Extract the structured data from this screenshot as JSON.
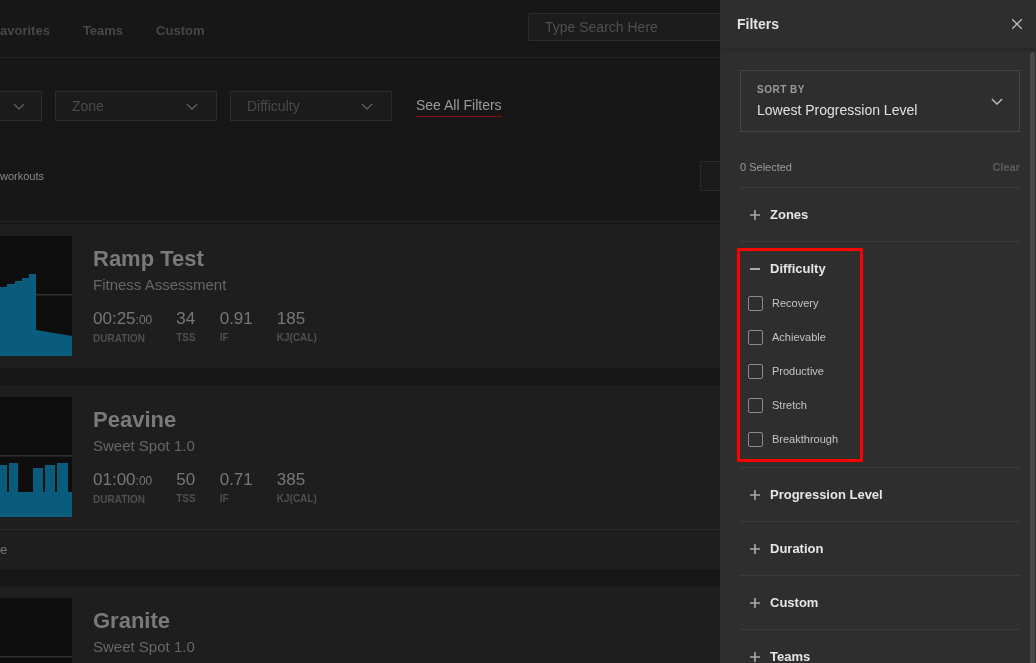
{
  "nav": {
    "tabs": [
      {
        "label": "avorites",
        "selected": false
      },
      {
        "label": "Teams",
        "selected": false
      },
      {
        "label": "Custom",
        "selected": false
      }
    ],
    "search": {
      "placeholder": "Type Search Here"
    }
  },
  "filter_bar": {
    "dropdowns": [
      {
        "kind": "clipped"
      },
      {
        "kind": "select",
        "placeholder": "Zone"
      },
      {
        "kind": "select",
        "placeholder": "Difficulty"
      }
    ],
    "link": "See All Filters"
  },
  "results": {
    "count_text": "workouts"
  },
  "workouts": [
    {
      "title": "Ramp Test",
      "subtitle": "Fitness Assessment",
      "graph": {
        "kind": "ramp"
      },
      "stats": [
        {
          "value": "00:25",
          "suffix": ":00",
          "label": "DURATION"
        },
        {
          "value": "34",
          "label": "TSS"
        },
        {
          "value": "0.91",
          "label": "IF"
        },
        {
          "value": "185",
          "label": "KJ(CAL)"
        }
      ]
    },
    {
      "title": "Peavine",
      "subtitle": "Sweet Spot 1.0",
      "graph": {
        "kind": "intervals"
      },
      "stats": [
        {
          "value": "01:00",
          "suffix": ":00",
          "label": "DURATION"
        },
        {
          "value": "50",
          "label": "TSS"
        },
        {
          "value": "0.71",
          "label": "IF"
        },
        {
          "value": "385",
          "label": "KJ(CAL)"
        }
      ],
      "footer": "e"
    },
    {
      "title": "Granite",
      "subtitle": "Sweet Spot 1.0",
      "graph": {
        "kind": "blank"
      }
    }
  ],
  "filter_panel": {
    "title": "Filters",
    "sort": {
      "label": "SORT BY",
      "value": "Lowest Progression Level"
    },
    "selected_count": "0 Selected",
    "clear": "Clear",
    "sections": [
      {
        "label": "Zones",
        "expanded": false,
        "highlighted": false
      },
      {
        "label": "Difficulty",
        "expanded": true,
        "highlighted": true,
        "options": [
          {
            "label": "Recovery",
            "checked": false
          },
          {
            "label": "Achievable",
            "checked": false
          },
          {
            "label": "Productive",
            "checked": false
          },
          {
            "label": "Stretch",
            "checked": false
          },
          {
            "label": "Breakthrough",
            "checked": false
          }
        ]
      },
      {
        "label": "Progression Level",
        "expanded": false,
        "highlighted": false
      },
      {
        "label": "Duration",
        "expanded": false,
        "highlighted": false
      },
      {
        "label": "Custom",
        "expanded": false,
        "highlighted": false
      },
      {
        "label": "Teams",
        "expanded": false,
        "highlighted": false
      }
    ]
  }
}
